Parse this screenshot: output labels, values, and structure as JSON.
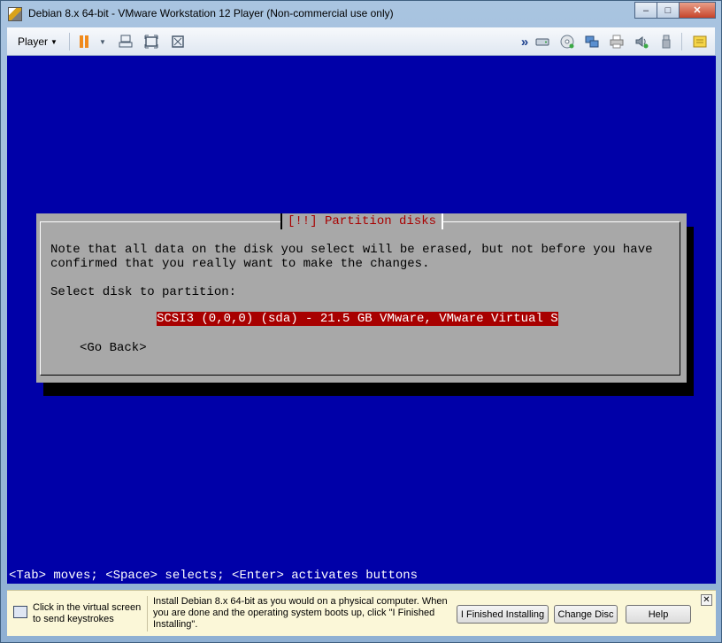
{
  "window": {
    "title": "Debian 8.x 64-bit - VMware Workstation 12 Player (Non-commercial use only)",
    "controls": {
      "minimize": "–",
      "maximize": "□",
      "close": "✕"
    }
  },
  "toolbar": {
    "player_label": "Player",
    "player_arrow": "▼",
    "pause_arrow": "▼",
    "more": "»",
    "icons": [
      "pause-icon",
      "send-ctrl-alt-del-icon",
      "fullscreen-icon",
      "unity-icon",
      "hard-disk-icon",
      "cd-dvd-icon",
      "network-adapter-icon",
      "printer-icon",
      "sound-card-icon",
      "usb-icon",
      "message-log-icon"
    ]
  },
  "installer": {
    "dialog_title": "[!!] Partition disks",
    "message_line1": "Note that all data on the disk you select will be erased, but not before you have",
    "message_line2": "confirmed that you really want to make the changes.",
    "prompt": "Select disk to partition:",
    "disk_option": "SCSI3 (0,0,0) (sda) - 21.5 GB VMware, VMware Virtual S",
    "go_back": "<Go Back>",
    "help_line": "<Tab> moves; <Space> selects; <Enter> activates buttons"
  },
  "infobar": {
    "keyboard_hint": "Click in the virtual screen to send keystrokes",
    "message": "Install Debian 8.x 64-bit as you would on a physical computer. When you are done and the operating system boots up, click \"I Finished Installing\".",
    "finished_button": "I Finished Installing",
    "change_disc_button": "Change Disc",
    "help_button": "Help",
    "close": "✕"
  },
  "colors": {
    "screen_bg": "#0000a8",
    "dialog_bg": "#a8a8a8",
    "highlight": "#a80000",
    "pause_orange": "#f08a1c"
  }
}
